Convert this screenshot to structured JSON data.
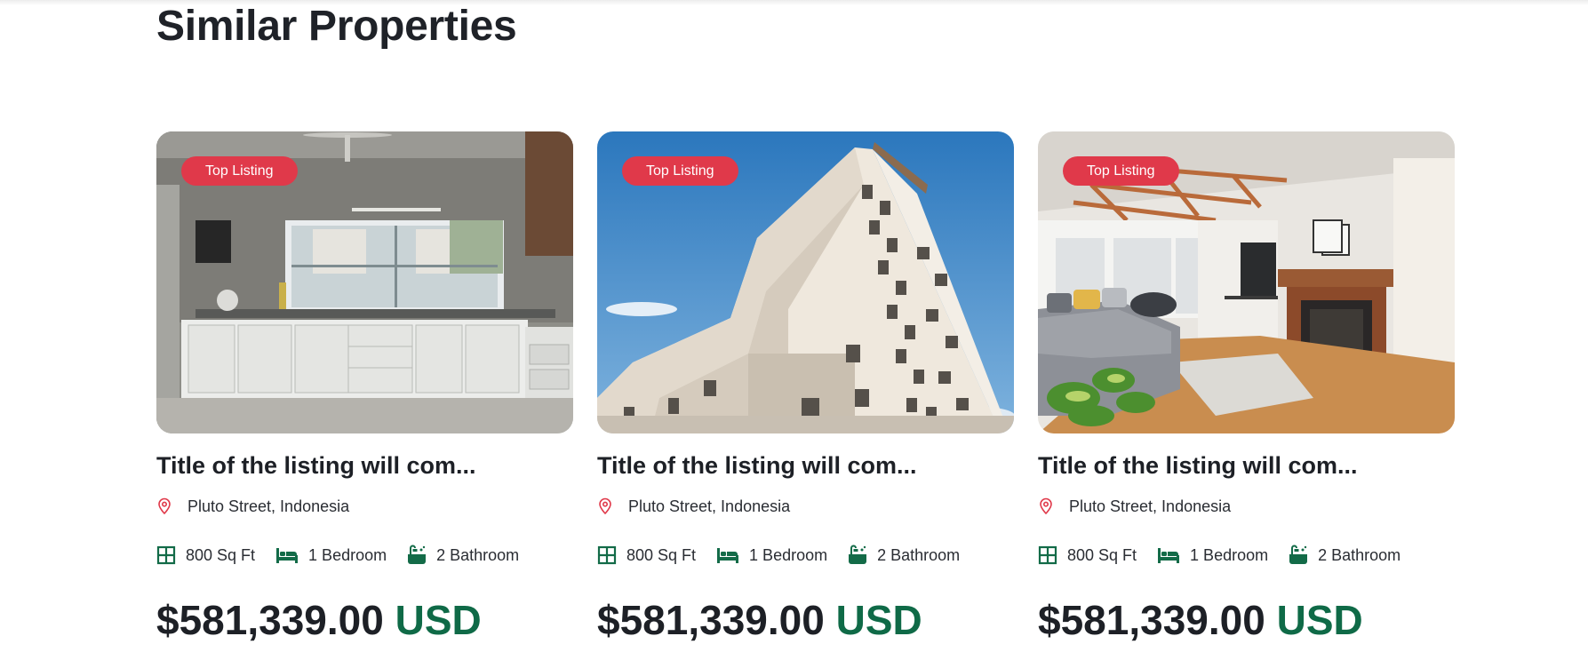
{
  "section": {
    "title": "Similar Properties"
  },
  "listings": [
    {
      "badge": "Top Listing",
      "title": "Title of the listing will com...",
      "location": "Pluto Street, Indonesia",
      "area": "800 Sq Ft",
      "bedrooms": "1 Bedroom",
      "bathrooms": "2 Bathroom",
      "price_amount": "$581,339.00",
      "price_currency": "USD",
      "image": "kitchen-photo"
    },
    {
      "badge": "Top Listing",
      "title": "Title of the listing will com...",
      "location": "Pluto Street, Indonesia",
      "area": "800 Sq Ft",
      "bedrooms": "1 Bedroom",
      "bathrooms": "2 Bathroom",
      "price_amount": "$581,339.00",
      "price_currency": "USD",
      "image": "apartment-building-photo"
    },
    {
      "badge": "Top Listing",
      "title": "Title of the listing will com...",
      "location": "Pluto Street, Indonesia",
      "area": "800 Sq Ft",
      "bedrooms": "1 Bedroom",
      "bathrooms": "2 Bathroom",
      "price_amount": "$581,339.00",
      "price_currency": "USD",
      "image": "living-room-photo"
    }
  ],
  "colors": {
    "badge": "#e0394a",
    "currency": "#0f6a47",
    "icon": "#136b48",
    "pin": "#e0394a"
  },
  "icons": {
    "location": "map-pin-icon",
    "area": "floor-plan-icon",
    "bedrooms": "bed-icon",
    "bathrooms": "bathtub-icon"
  }
}
